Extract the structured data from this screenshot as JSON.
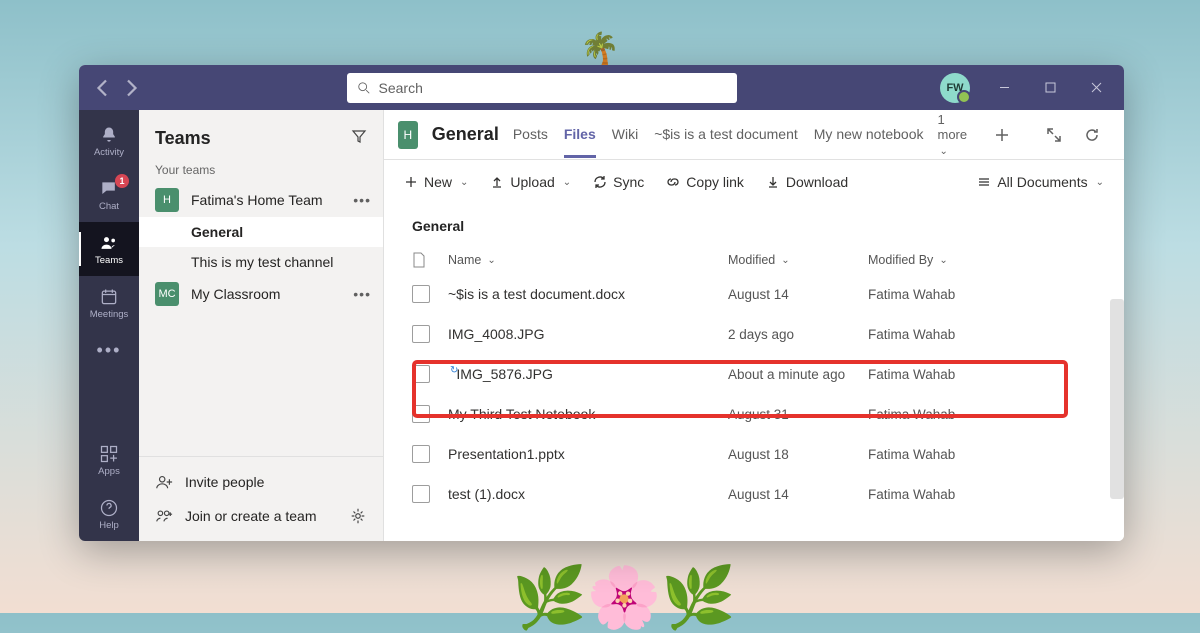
{
  "titlebar": {
    "search_placeholder": "Search",
    "avatar_initials": "FW"
  },
  "rail": {
    "items": [
      {
        "id": "activity",
        "label": "Activity"
      },
      {
        "id": "chat",
        "label": "Chat",
        "badge": "1"
      },
      {
        "id": "teams",
        "label": "Teams"
      },
      {
        "id": "meetings",
        "label": "Meetings"
      }
    ],
    "bottom": [
      {
        "id": "apps",
        "label": "Apps"
      },
      {
        "id": "help",
        "label": "Help"
      }
    ]
  },
  "panel": {
    "title": "Teams",
    "subheading": "Your teams",
    "teams": [
      {
        "initial": "H",
        "color": "#4a8f6d",
        "name": "Fatima's Home Team",
        "channels": [
          {
            "name": "General",
            "selected": true
          },
          {
            "name": "This is my test channel",
            "selected": false
          }
        ]
      },
      {
        "initial": "MC",
        "color": "#4a8f6d",
        "name": "My Classroom",
        "channels": []
      }
    ],
    "footer": {
      "invite": "Invite people",
      "join": "Join or create a team"
    }
  },
  "main": {
    "channel_initial": "H",
    "channel_name": "General",
    "tabs": [
      {
        "label": "Posts"
      },
      {
        "label": "Files",
        "active": true
      },
      {
        "label": "Wiki"
      },
      {
        "label": "~$is is a test document"
      },
      {
        "label": "My new notebook"
      }
    ],
    "more_tabs": "1 more",
    "toolbar": {
      "new": "New",
      "upload": "Upload",
      "sync": "Sync",
      "copy": "Copy link",
      "download": "Download",
      "view": "All Documents"
    },
    "breadcrumb": "General",
    "columns": {
      "name": "Name",
      "modified": "Modified",
      "by": "Modified By"
    },
    "files": [
      {
        "icon": "word",
        "name": "~$is is a test document.docx",
        "modified": "August 14",
        "by": "Fatima Wahab"
      },
      {
        "icon": "img",
        "name": "IMG_4008.JPG",
        "modified": "2 days ago",
        "by": "Fatima Wahab"
      },
      {
        "icon": "img",
        "name": "IMG_5876.JPG",
        "modified": "About a minute ago",
        "by": "Fatima Wahab",
        "highlight": true,
        "syncing": true
      },
      {
        "icon": "note",
        "name": "My Third Test Notebook",
        "modified": "August 31",
        "by": "Fatima Wahab"
      },
      {
        "icon": "ppt",
        "name": "Presentation1.pptx",
        "modified": "August 18",
        "by": "Fatima Wahab"
      },
      {
        "icon": "word",
        "name": "test (1).docx",
        "modified": "August 14",
        "by": "Fatima Wahab"
      }
    ]
  }
}
